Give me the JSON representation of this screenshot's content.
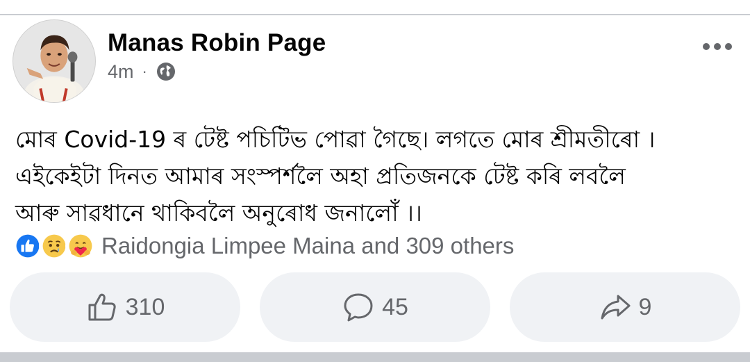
{
  "post": {
    "page_name": "Manas Robin Page",
    "time": "4m",
    "separator": "·",
    "privacy_icon": "globe-icon",
    "more_icon": "more-options-icon",
    "text_lines": [
      "মোৰ Covid-19 ৰ টেষ্ট পচিটিভ পোৱা গৈছে। লগতে মোৰ শ্ৰীমতীৰো ।",
      "এইকেইটা দিনত আমাৰ সংস্পৰ্শলৈ অহা প্ৰতিজনকে টেষ্ট কৰি লবলৈ",
      "আৰু সাৱধানে থাকিবলৈ অনুৰোধ জনালোঁ ।।"
    ]
  },
  "reactions": {
    "icons": [
      "like-reaction-icon",
      "sad-reaction-icon",
      "care-reaction-icon"
    ],
    "summary": "Raidongia Limpee Maina and 309 others"
  },
  "actions": {
    "like_count": "310",
    "comment_count": "45",
    "share_count": "9"
  },
  "colors": {
    "text": "#050505",
    "secondary": "#65676b",
    "button_bg": "#f0f2f5",
    "like_blue": "#1877f2",
    "divider": "#c9ccd1"
  }
}
